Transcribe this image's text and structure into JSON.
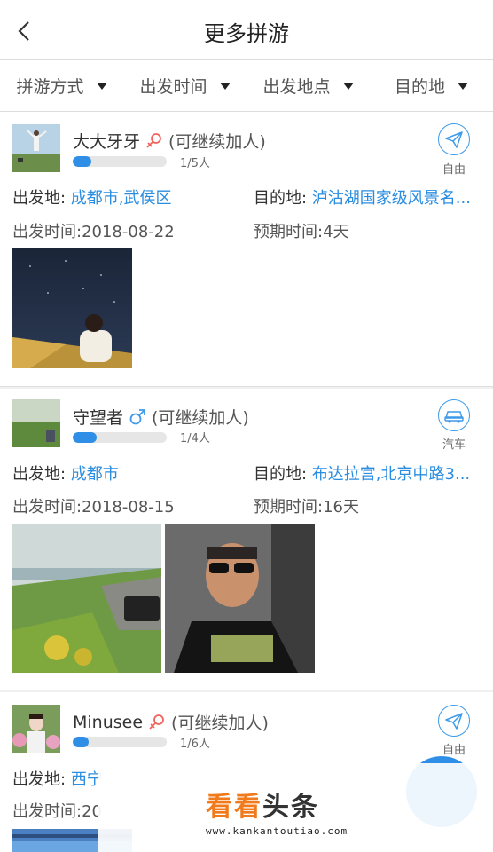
{
  "header": {
    "title": "更多拼游",
    "back_icon": "chevron-left-icon"
  },
  "filters": [
    {
      "label": "拼游方式"
    },
    {
      "label": "出发时间"
    },
    {
      "label": "出发地点"
    },
    {
      "label": "目的地"
    }
  ],
  "labels": {
    "depart_place": "出发地:",
    "destination": "目的地:",
    "depart_time": "出发时间:",
    "expected_time": "预期时间:"
  },
  "cards": [
    {
      "name": "大大牙牙",
      "gender": "female",
      "status": "(可继续加人)",
      "progress": 0.2,
      "count": "1/5人",
      "mode": "自由",
      "mode_icon": "paper-plane-icon",
      "depart_place": "成都市,武侯区",
      "destination": "泸沽湖国家级风景名...",
      "depart_time": "2018-08-22",
      "expected_time": "4天"
    },
    {
      "name": "守望者",
      "gender": "male",
      "status": "(可继续加人)",
      "progress": 0.25,
      "count": "1/4人",
      "mode": "汽车",
      "mode_icon": "car-icon",
      "depart_place": "成都市",
      "destination": "布达拉宫,北京中路3...",
      "depart_time": "2018-08-15",
      "expected_time": "16天"
    },
    {
      "name": "Minusee",
      "gender": "female",
      "status": "(可继续加人)",
      "progress": 0.17,
      "count": "1/6人",
      "mode": "自由",
      "mode_icon": "paper-plane-icon",
      "depart_place": "西宁",
      "depart_time": "20"
    }
  ],
  "watermark": {
    "title_a": "看看",
    "title_b": "头条",
    "url": "www.kankantoutiao.com"
  },
  "colors": {
    "accent": "#2f8fe6",
    "link": "#2b8de0",
    "female": "#f0645a",
    "male": "#3d9ae8",
    "watermark": "#f07a1c"
  }
}
